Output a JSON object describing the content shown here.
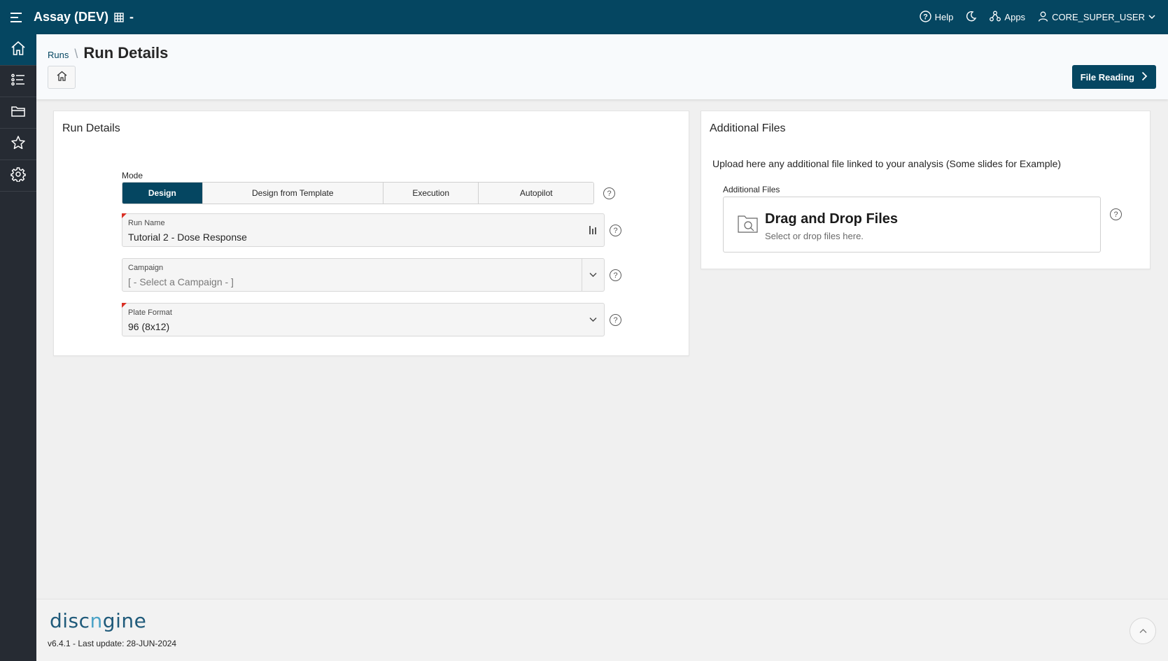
{
  "topbar": {
    "app_title": "Assay (DEV)",
    "title_suffix": "-",
    "help_label": "Help",
    "apps_label": "Apps",
    "user_label": "CORE_SUPER_USER"
  },
  "sidebar": {
    "items": [
      {
        "icon": "home-icon",
        "active": true
      },
      {
        "icon": "list-icon",
        "active": false
      },
      {
        "icon": "folder-icon",
        "active": false
      },
      {
        "icon": "star-icon",
        "active": false
      },
      {
        "icon": "gear-icon",
        "active": false
      }
    ]
  },
  "header": {
    "breadcrumb_link": "Runs",
    "breadcrumb_sep": "\\",
    "page_title": "Run Details",
    "next_button": "File Reading"
  },
  "run_card": {
    "title": "Run Details",
    "mode_label": "Mode",
    "modes": [
      "Design",
      "Design from Template",
      "Execution",
      "Autopilot"
    ],
    "active_mode": "Design",
    "fields": {
      "run_name": {
        "label": "Run Name",
        "value": "Tutorial 2 - Dose Response"
      },
      "campaign": {
        "label": "Campaign",
        "placeholder": "[ - Select a Campaign - ]"
      },
      "plate_format": {
        "label": "Plate Format",
        "value": "96 (8x12)"
      }
    }
  },
  "files_card": {
    "title": "Additional Files",
    "description": "Upload here any additional file linked to your analysis (Some slides for Example)",
    "field_label": "Additional Files",
    "drop_title": "Drag and Drop Files",
    "drop_subtitle": "Select or drop files here."
  },
  "footer": {
    "logo_text_a": "disc",
    "logo_text_n": "n",
    "logo_text_b": "gine",
    "version": "v6.4.1 - Last update: 28-JUN-2024"
  },
  "colors": {
    "brand": "#054661",
    "sidebar": "#262b33",
    "required": "#d93025"
  }
}
